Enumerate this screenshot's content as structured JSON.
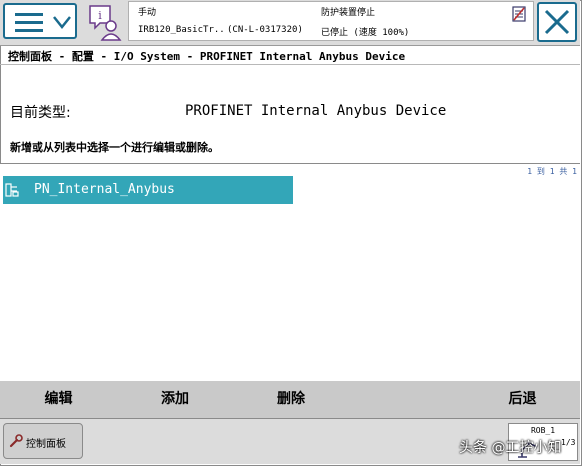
{
  "status": {
    "mode": "手动",
    "controller": "IRB120_BasicTr..",
    "system_id": "(CN-L-0317320)",
    "guard_state": "防护装置停止",
    "run_state": "已停止 (速度 100%)"
  },
  "breadcrumb": "控制面板 - 配置 - I/O System - PROFINET Internal Anybus Device",
  "current_type": {
    "label": "目前类型:",
    "value": "PROFINET Internal Anybus Device"
  },
  "instruction": "新增或从列表中选择一个进行编辑或删除。",
  "list": {
    "pager": "1 到 1 共 1",
    "items": [
      {
        "label": "PN_Internal_Anybus",
        "icon": "device-config-icon",
        "selected": true
      }
    ]
  },
  "commands": {
    "edit": "编辑",
    "add": "添加",
    "delete": "删除",
    "back": "后退"
  },
  "taskbar": {
    "control_panel": "控制面板",
    "rob_label": "ROB_1",
    "rob_number": "1/3"
  },
  "watermark": "头条 @工控小知",
  "colors": {
    "accent": "#1a6b8e",
    "selection": "#33a6b8",
    "command_bar": "#c9c9c9"
  }
}
